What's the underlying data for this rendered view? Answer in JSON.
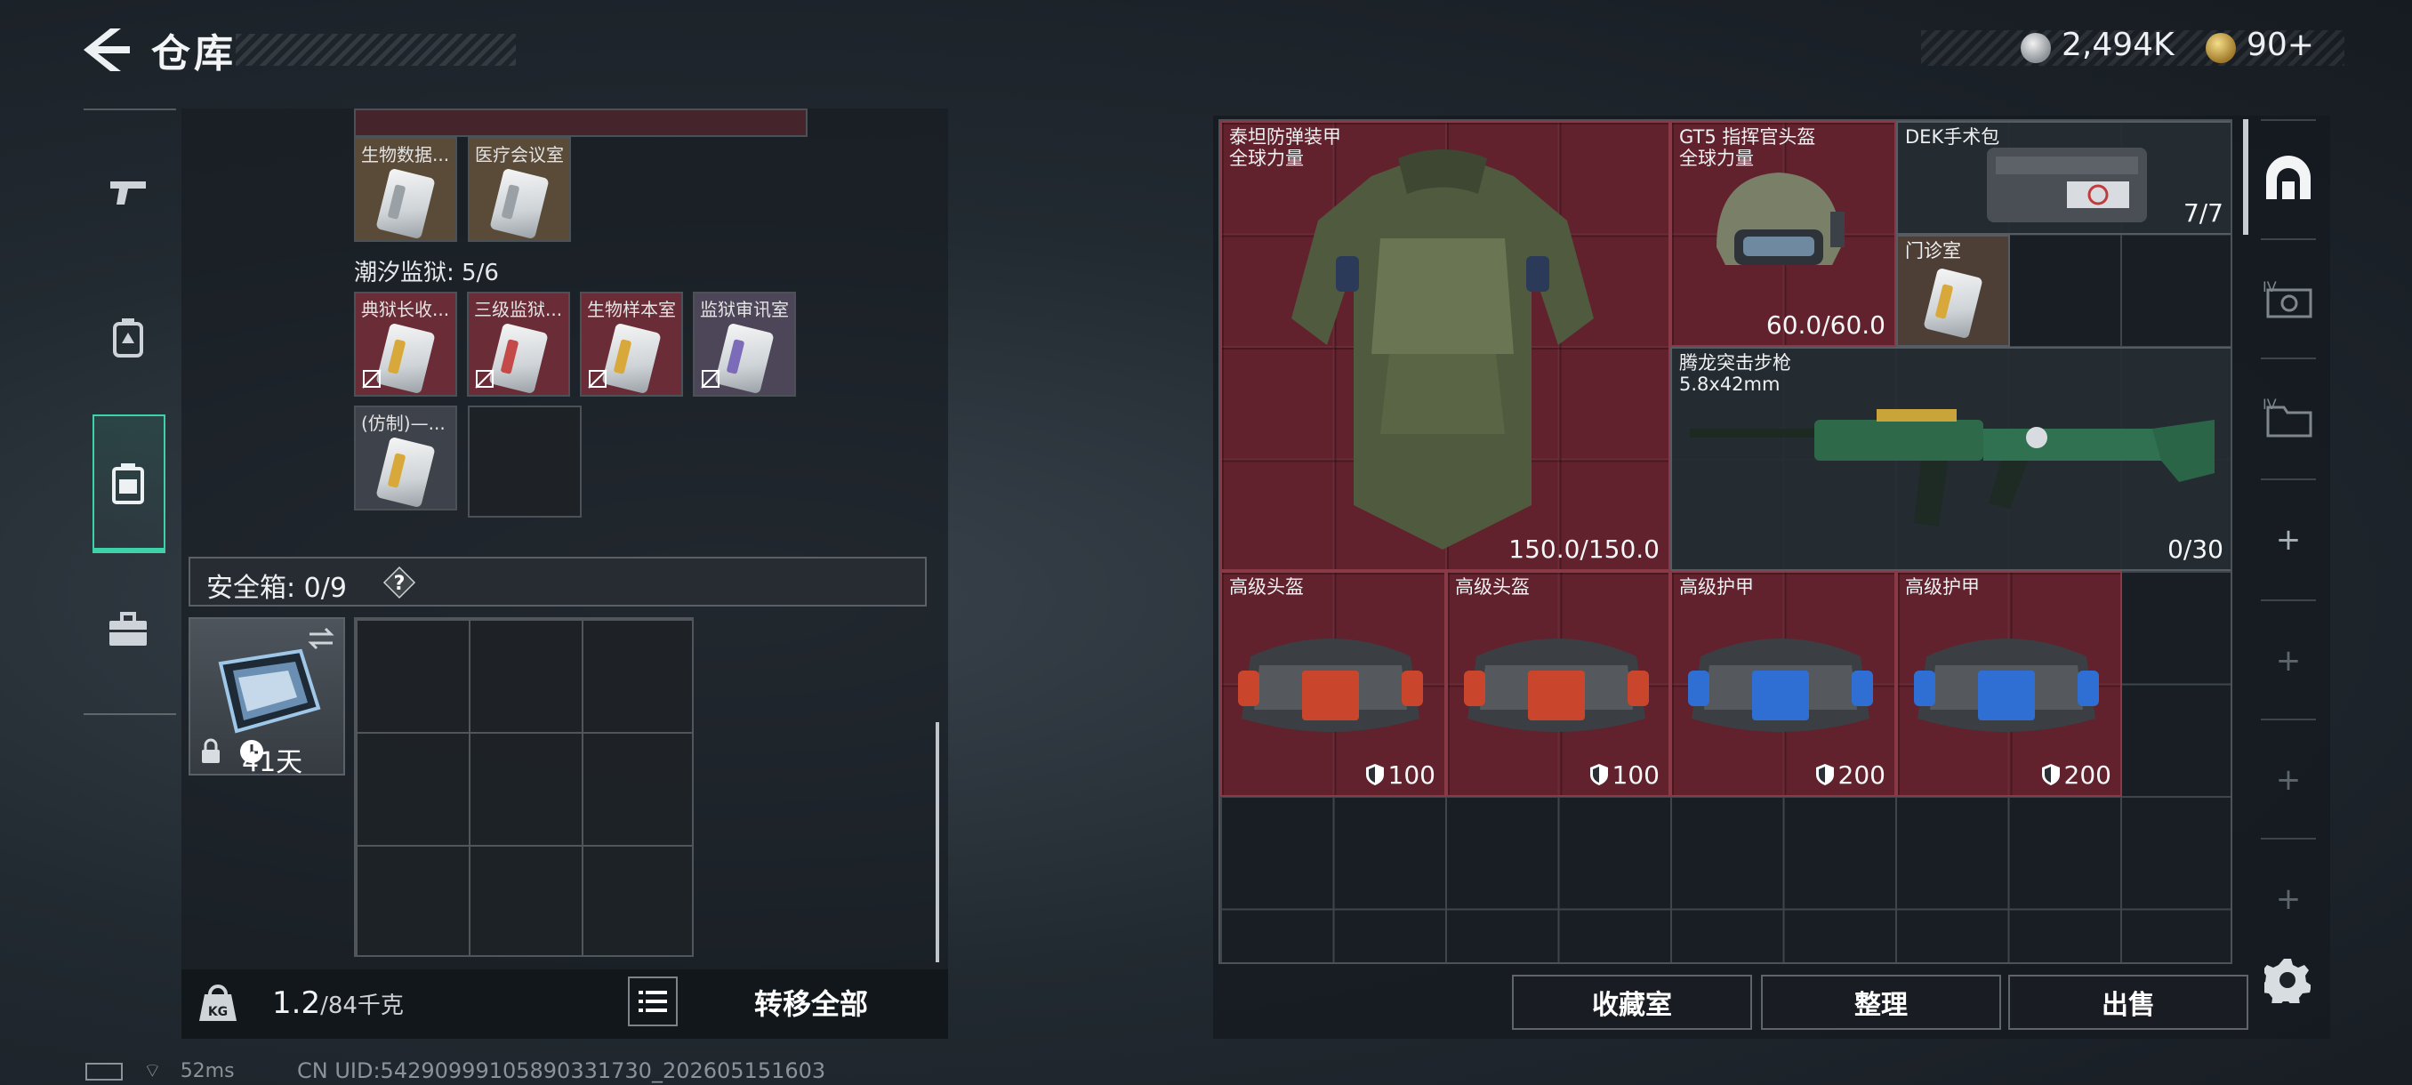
{
  "header": {
    "title": "仓库",
    "currency_silver": "2,494K",
    "currency_gold": "90+"
  },
  "nav": {
    "items": [
      "weapon-icon",
      "backpack-icon",
      "case-icon",
      "toolbox-icon"
    ],
    "active_index": 2
  },
  "storage": {
    "top_row_cards": [
      {
        "label": "生物数据...",
        "stripe": "#9aa1a6"
      },
      {
        "label": "医疗会议室",
        "stripe": "#9aa1a6"
      }
    ],
    "section_title": "潮汐监狱: 5/6",
    "prison_cards": [
      {
        "label": "典狱长收...",
        "stripe": "#d8a93a"
      },
      {
        "label": "三级监狱...",
        "stripe": "#c44a4a"
      },
      {
        "label": "生物样本室",
        "stripe": "#d8a93a"
      },
      {
        "label": "监狱审讯室",
        "stripe": "#7b6bb8"
      }
    ],
    "bottom_card": {
      "label": "(仿制)—...",
      "stripe": "#d8a93a"
    },
    "safe_label": "安全箱: 0/9",
    "safe_help": "?",
    "safe_days": "41天",
    "weight_value": "1.2",
    "weight_unit": "/84千克",
    "transfer_all": "转移全部"
  },
  "status": {
    "ping": "52ms",
    "uid": "CN UID:54290999105890331730_202605151603"
  },
  "equipment": {
    "armor": {
      "name_line1": "泰坦防弹装甲",
      "name_line2": "全球力量",
      "durability": "150.0/150.0"
    },
    "helmet": {
      "name_line1": "GT5 指挥官头盔",
      "name_line2": "全球力量",
      "durability": "60.0/60.0"
    },
    "medkit": {
      "name": "DEK手术包",
      "count": "7/7"
    },
    "clinic_card": {
      "label": "门诊室",
      "stripe": "#d8a93a"
    },
    "rifle": {
      "name_line1": "腾龙突击步枪",
      "name_line2": "5.8x42mm",
      "ammo": "0/30"
    },
    "bags": [
      {
        "label": "高级头盔",
        "value": "100",
        "accent": "#c9462c"
      },
      {
        "label": "高级头盔",
        "value": "100",
        "accent": "#c9462c"
      },
      {
        "label": "高级护甲",
        "value": "200",
        "accent": "#2f6fd3"
      },
      {
        "label": "高级护甲",
        "value": "200",
        "accent": "#2f6fd3"
      }
    ]
  },
  "actions": {
    "collection": "收藏室",
    "organize": "整理",
    "sell": "出售"
  },
  "side_nav": {
    "items": [
      "vault-icon",
      "level4-storage-icon",
      "level4-folder-icon",
      "plus-icon",
      "plus-icon",
      "plus-icon",
      "plus-icon"
    ]
  }
}
